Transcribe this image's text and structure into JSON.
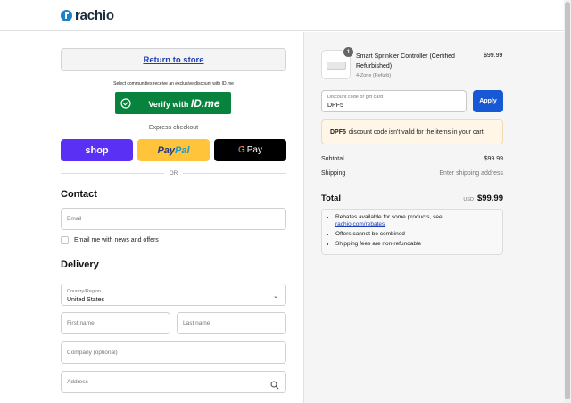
{
  "header": {
    "brand": "rachio"
  },
  "left": {
    "return_label": "Return to store",
    "idme_note": "Select communities receive an exclusive discount with ID.me",
    "idme_button": {
      "prefix": "Verify with",
      "brand": "ID.me"
    },
    "express_label": "Express checkout",
    "pay_buttons": {
      "shop": "shop",
      "paypal_a": "Pay",
      "paypal_b": "Pal",
      "gpay_g": "G",
      "gpay_text": "Pay"
    },
    "or_label": "OR",
    "contact": {
      "title": "Contact",
      "email_placeholder": "Email",
      "newsletter_label": "Email me with news and offers"
    },
    "delivery": {
      "title": "Delivery",
      "country_label": "Country/Region",
      "country_value": "United States",
      "first_name_placeholder": "First name",
      "last_name_placeholder": "Last name",
      "company_placeholder": "Company (optional)",
      "address_placeholder": "Address"
    }
  },
  "summary": {
    "product": {
      "quantity": "1",
      "name": "Smart Sprinkler Controller (Certified Refurbished)",
      "variant": "4-Zone (Refurb)",
      "price": "$99.99"
    },
    "discount": {
      "label": "Discount code or gift card",
      "value": "DPF5",
      "apply_label": "Apply",
      "error_code": "DPF5",
      "error_text": "discount code isn't valid for the items in your cart"
    },
    "subtotal": {
      "label": "Subtotal",
      "value": "$99.99"
    },
    "shipping": {
      "label": "Shipping",
      "value": "Enter shipping address"
    },
    "total": {
      "label": "Total",
      "currency": "USD",
      "value": "$99.99"
    },
    "notes": {
      "item1": "Rebates available for some products, see",
      "item1_link": "rachio.com/rebates",
      "item2": "Offers cannot be combined",
      "item3": "Shipping fees are non-refundable"
    }
  },
  "colors": {
    "brand_blue": "#1b82c9",
    "link": "#1f3fb5",
    "apply": "#1758d4",
    "idme_green": "#08833d",
    "shop_purple": "#5a31f4",
    "paypal_yellow": "#ffc439",
    "error_bg": "#fff6e8"
  }
}
